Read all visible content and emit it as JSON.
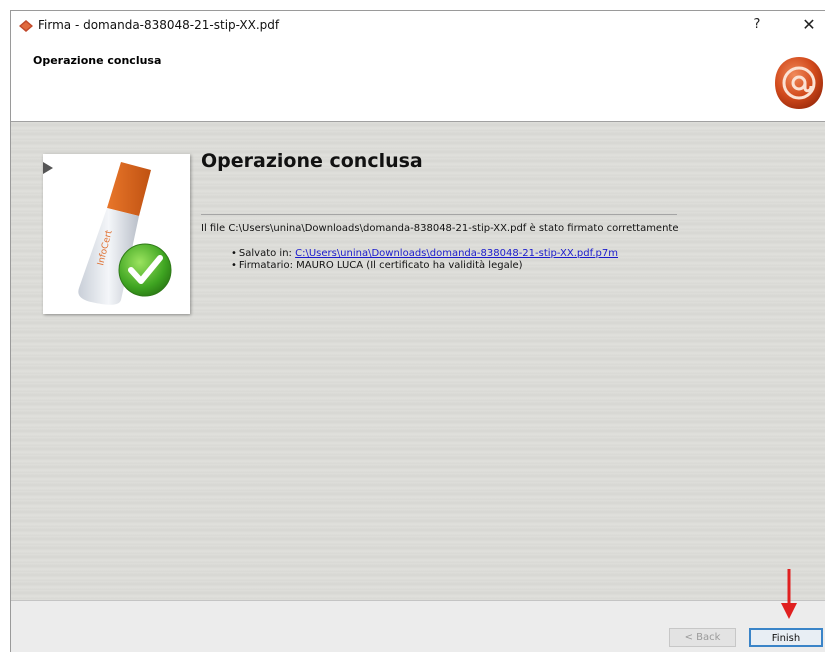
{
  "window": {
    "title": "Firma - domanda-838048-21-stip-XX.pdf",
    "help_label": "?",
    "close_label": "✕"
  },
  "header": {
    "title": "Operazione conclusa",
    "logo_icon": "seal-at-icon"
  },
  "content": {
    "title": "Operazione conclusa",
    "illustration_icon": "usb-token-check-icon",
    "message": "Il file C:\\Users\\unina\\Downloads\\domanda-838048-21-stip-XX.pdf è stato firmato correttamente",
    "details": {
      "saved_label": "Salvato in: ",
      "saved_path": "C:\\Users\\unina\\Downloads\\domanda-838048-21-stip-XX.pdf.p7m",
      "signer": "Firmatario: MAURO LUCA (Il certificato ha validità legale)"
    }
  },
  "footer": {
    "back_label": "< Back",
    "finish_label": "Finish"
  },
  "colors": {
    "accent": "#3a84c8",
    "link": "#1a1acc",
    "annotation_arrow": "#e02020",
    "seal": "#d24a1c"
  }
}
